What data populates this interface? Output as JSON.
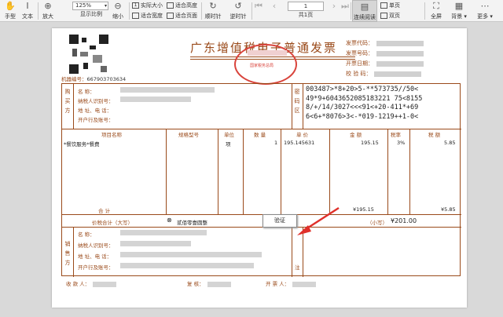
{
  "toolbar": {
    "hand": "手型",
    "text": "文本",
    "zoom_in": "放大",
    "display_ratio": "显示比例",
    "zoom_out": "缩小",
    "zoom_value": "125%",
    "actual_size": "实际大小",
    "fit_height": "适合高度",
    "fit_width": "适合宽度",
    "fit_page": "适合页面",
    "rotate_cw": "顺时针",
    "rotate_ccw": "逆时针",
    "page_number": "1",
    "page_total": "共1页",
    "continuous": "连续阅读",
    "single": "单页",
    "double": "双页",
    "fullscreen": "全屏",
    "background": "背景",
    "more": "更多"
  },
  "invoice": {
    "title": "广东增值税电子普通发票",
    "seal_text": "国家税务总局",
    "machine_label": "机器编号：",
    "machine_number": "667903703634",
    "meta_labels": [
      "发票代码：",
      "发票号码：",
      "开票日期：",
      "校 验 码："
    ],
    "buyer_side": [
      "购",
      "买",
      "方"
    ],
    "buyer_labels": [
      "名      称：",
      "纳税人识别号：",
      "地 址、电 话：",
      "开户行及账号："
    ],
    "cipher_side": [
      "密",
      "码",
      "区"
    ],
    "cipher_lines": [
      "003487>*8+20>5-**573735//50<",
      "49*9+6043652085183221 75<8155",
      "8/+/14/3027<<<91<+20-411*+69",
      "6<6+*8076>3<-*019-1219++1-0<"
    ],
    "columns": [
      "项目名称",
      "规格型号",
      "单位",
      "数 量",
      "单 价",
      "金 额",
      "税率",
      "税 额"
    ],
    "item": {
      "name": "*餐饮服务*餐费",
      "unit": "项",
      "quantity": "1",
      "price": "195.145631",
      "amount": "195.15",
      "tax_rate": "3%",
      "tax": "5.85"
    },
    "total_label": "合 计",
    "total_amount": "¥195.15",
    "total_tax": "¥5.85",
    "grand_label": "价税合计（大写）",
    "grand_upper": "贰佰零壹圆整",
    "small_label": "（小写）",
    "grand_small": "¥201.00",
    "seller_side": [
      "销",
      "售",
      "方"
    ],
    "seller_labels": [
      "名      称：",
      "纳税人识别号：",
      "地 址、电 话：",
      "开户行及账号："
    ],
    "remark_side": "注",
    "verify": "验证",
    "footer": [
      "收 款 人：",
      "复 核：",
      "开 票 人："
    ]
  }
}
